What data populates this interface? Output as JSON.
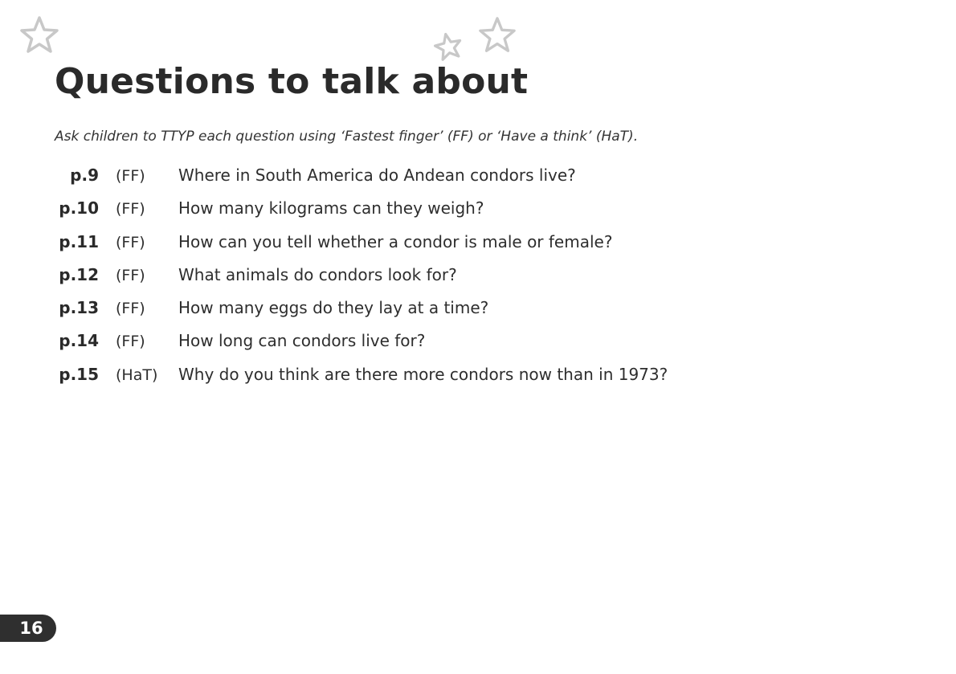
{
  "page": {
    "title": "Questions to talk about",
    "instructions": "Ask children to TTYP each question using ‘Fastest finger’ (FF) or ‘Have a think’ (HaT).",
    "page_number": "16"
  },
  "questions": [
    {
      "page": "p.9",
      "type": "(FF)",
      "text": "Where in South America do Andean condors live?"
    },
    {
      "page": "p.10",
      "type": "(FF)",
      "text": "How many kilograms can they weigh?"
    },
    {
      "page": "p.11",
      "type": "(FF)",
      "text": "How can you tell whether a condor is male or female?"
    },
    {
      "page": "p.12",
      "type": "(FF)",
      "text": "What animals do condors look for?"
    },
    {
      "page": "p.13",
      "type": "(FF)",
      "text": "How many eggs do they lay at a time?"
    },
    {
      "page": "p.14",
      "type": "(FF)",
      "text": "How long can condors live for?"
    },
    {
      "page": "p.15",
      "type": "(HaT)",
      "text": "Why do you think are there more condors now than in 1973?"
    }
  ],
  "decorations": {
    "icon": "star-outline-icon",
    "star_color": "#c8c8c8",
    "badge_color": "#2f2f2f"
  }
}
